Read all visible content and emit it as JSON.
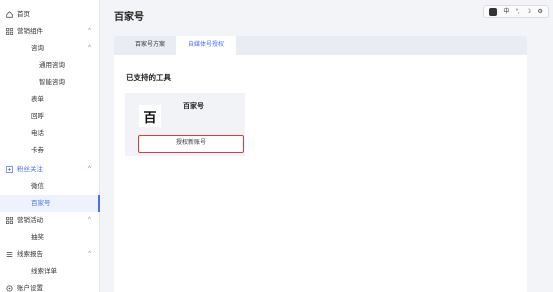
{
  "page_title": "百家号",
  "toolbar": {
    "items": [
      "中",
      "°,",
      "☽",
      "⚙"
    ]
  },
  "sidebar": {
    "items": [
      {
        "label": "首页",
        "icon": "home-icon"
      },
      {
        "label": "营销组件",
        "icon": "grid-icon",
        "expanded": true
      },
      {
        "label": "咨询",
        "expanded": true
      },
      {
        "label": "通用咨询"
      },
      {
        "label": "智能咨询"
      },
      {
        "label": "表单"
      },
      {
        "label": "回呼"
      },
      {
        "label": "电话"
      },
      {
        "label": "卡券"
      },
      {
        "label": "粉丝关注",
        "icon": "fans-icon",
        "expanded": true
      },
      {
        "label": "微信"
      },
      {
        "label": "百家号",
        "active": true
      },
      {
        "label": "营销活动",
        "icon": "grid-icon",
        "expanded": true
      },
      {
        "label": "抽奖"
      },
      {
        "label": "线索报告",
        "icon": "report-icon",
        "expanded": true
      },
      {
        "label": "线索详单"
      },
      {
        "label": "账户设置",
        "icon": "settings-icon"
      }
    ]
  },
  "tabs": [
    {
      "label": "百家号方案",
      "active": false
    },
    {
      "label": "自媒体号授权",
      "active": true
    }
  ],
  "main": {
    "section_title": "已支持的工具",
    "tool": {
      "logo_glyph": "百",
      "name": "百家号",
      "button_label": "授权新账号"
    }
  },
  "colors": {
    "accent": "#4c6ef5",
    "highlight_border": "#e03a3a"
  }
}
